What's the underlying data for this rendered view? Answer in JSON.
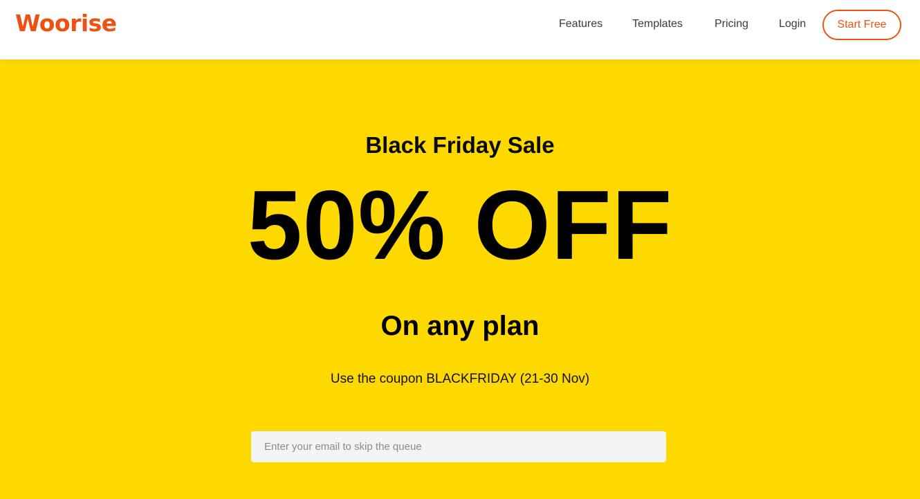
{
  "header": {
    "logo_text": "Woorise",
    "nav": {
      "features": "Features",
      "templates": "Templates",
      "pricing": "Pricing",
      "login": "Login"
    },
    "cta_label": "Start Free"
  },
  "hero": {
    "eyebrow": "Black Friday Sale",
    "headline": "50% OFF",
    "subhead": "On any plan",
    "coupon_text": "Use the coupon BLACKFRIDAY (21-30 Nov)",
    "email_placeholder": "Enter your email to skip the queue",
    "email_value": ""
  },
  "colors": {
    "brand": "#ee5213",
    "hero_background": "#fed900",
    "input_background": "#f4f4f4"
  }
}
